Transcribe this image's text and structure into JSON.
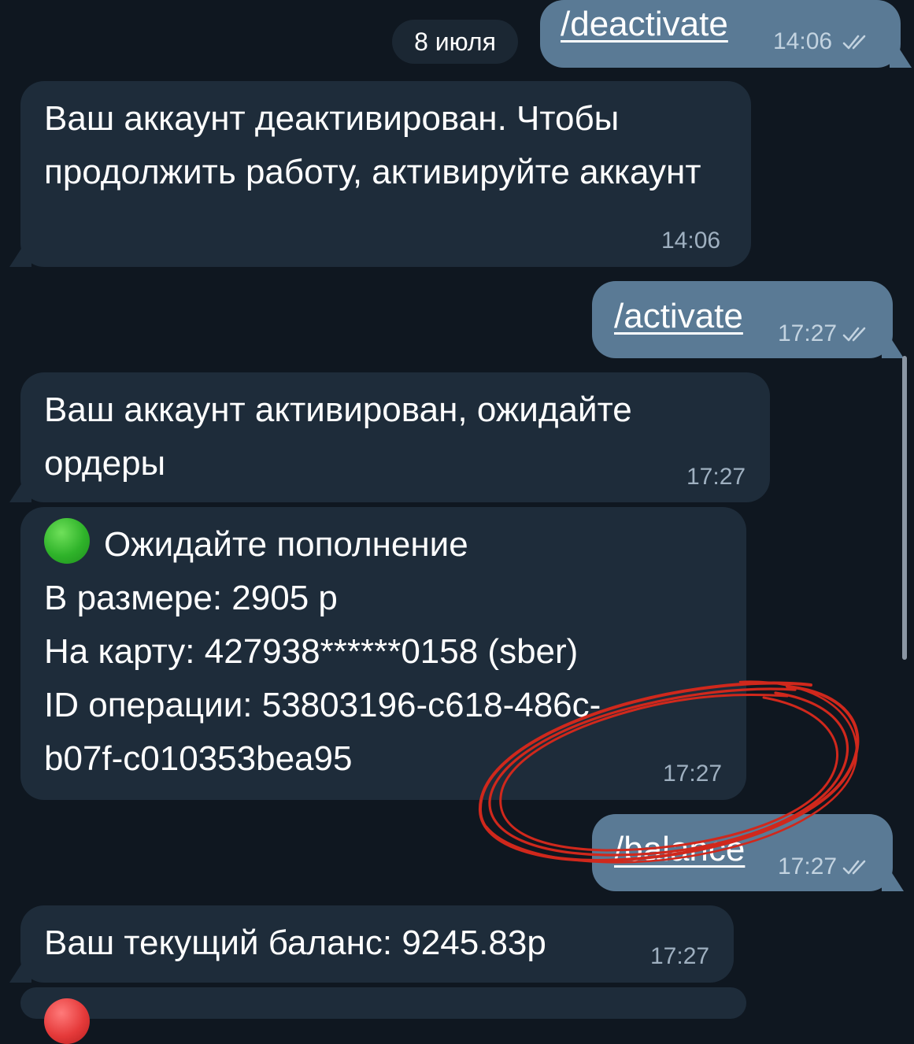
{
  "date_separator": "8 июля",
  "messages": [
    {
      "direction": "out",
      "text": "/deactivate",
      "time": "14:06",
      "read": true
    },
    {
      "direction": "in",
      "text": "Ваш аккаунт деактивирован. Чтобы продолжить работу, активируйте аккаунт",
      "time": "14:06"
    },
    {
      "direction": "out",
      "text": "/activate",
      "time": "17:27",
      "read": true
    },
    {
      "direction": "in",
      "text": "Ваш аккаунт активирован, ожидайте ордеры",
      "time": "17:27"
    },
    {
      "direction": "in",
      "lines": [
        "Ожидайте пополнение",
        "В размере: 2905 р",
        "На карту: 427938******0158 (sber)",
        "ID операции: 53803196-c618-486c-",
        "b07f-c010353bea95"
      ],
      "status_icon": "green-circle-emoji",
      "time": "17:27"
    },
    {
      "direction": "out",
      "text": "/balance",
      "time": "17:27",
      "read": true
    },
    {
      "direction": "in",
      "text": "Ваш текущий баланс: 9245.83р",
      "time": "17:27"
    },
    {
      "direction": "in",
      "status_icon": "red-circle-emoji",
      "partial": true
    }
  ],
  "colors": {
    "background": "#0f1720",
    "incoming_bubble": "#1e2c3a",
    "outgoing_bubble": "#5a7a95",
    "annotation_scribble": "#d0281c"
  },
  "annotation": "red-hand-drawn-circle"
}
